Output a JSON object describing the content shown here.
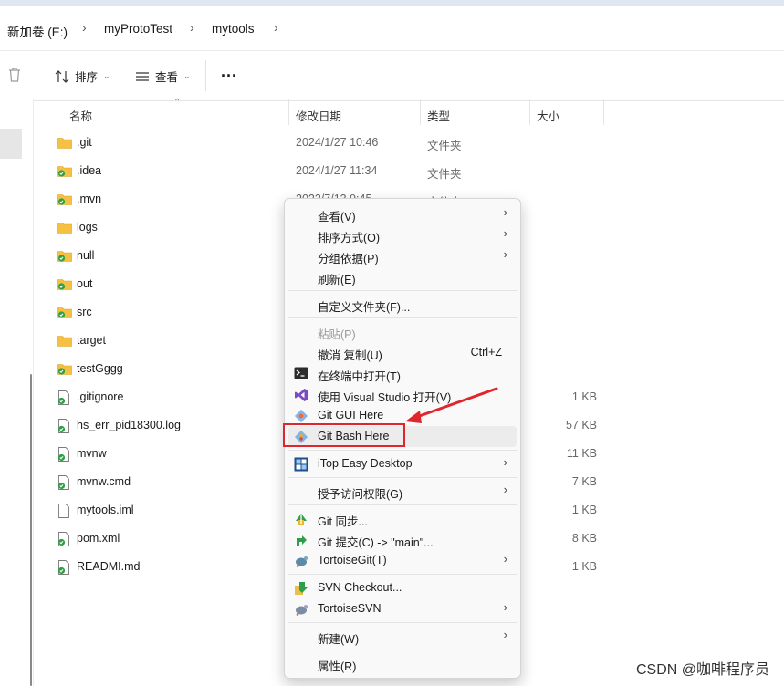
{
  "breadcrumb": {
    "items": [
      "新加卷 (E:)",
      "myProtoTest",
      "mytools"
    ],
    "separator": ">"
  },
  "toolbar": {
    "sort_label": "排序",
    "view_label": "查看",
    "more_label": "..."
  },
  "columns": {
    "name": "名称",
    "date": "修改日期",
    "type": "类型",
    "size": "大小"
  },
  "files": [
    {
      "name": ".git",
      "date": "2024/1/27 10:46",
      "type": "文件夹",
      "size": "",
      "kind": "folder"
    },
    {
      "name": ".idea",
      "date": "2024/1/27 11:34",
      "type": "文件夹",
      "size": "",
      "kind": "folder-ok"
    },
    {
      "name": ".mvn",
      "date": "2023/7/13 9:45",
      "type": "文件夹",
      "size": "",
      "kind": "folder-ok"
    },
    {
      "name": "logs",
      "date": "",
      "type": "",
      "size": "",
      "kind": "folder"
    },
    {
      "name": "null",
      "date": "",
      "type": "",
      "size": "",
      "kind": "folder-ok"
    },
    {
      "name": "out",
      "date": "",
      "type": "",
      "size": "",
      "kind": "folder-ok"
    },
    {
      "name": "src",
      "date": "",
      "type": "",
      "size": "",
      "kind": "folder-ok"
    },
    {
      "name": "target",
      "date": "",
      "type": "",
      "size": "",
      "kind": "folder"
    },
    {
      "name": "testGggg",
      "date": "",
      "type": "",
      "size": "",
      "kind": "folder-ok"
    },
    {
      "name": ".gitignore",
      "date": "",
      "type": "",
      "size": "1 KB",
      "kind": "file-ok"
    },
    {
      "name": "hs_err_pid18300.log",
      "date": "",
      "type": "",
      "size": "57 KB",
      "kind": "file-ok"
    },
    {
      "name": "mvnw",
      "date": "",
      "type": "",
      "size": "11 KB",
      "kind": "file-ok"
    },
    {
      "name": "mvnw.cmd",
      "date": "",
      "type": "",
      "size": "7 KB",
      "kind": "file-ok"
    },
    {
      "name": "mytools.iml",
      "date": "",
      "type": "",
      "size": "1 KB",
      "kind": "file"
    },
    {
      "name": "pom.xml",
      "date": "",
      "type": "",
      "size": "8 KB",
      "kind": "file-ok"
    },
    {
      "name": "READMI.md",
      "date": "",
      "type": "",
      "size": "1 KB",
      "kind": "file-ok"
    }
  ],
  "context_menu": {
    "groups": [
      [
        {
          "label": "查看(V)",
          "submenu": true
        },
        {
          "label": "排序方式(O)",
          "submenu": true
        },
        {
          "label": "分组依据(P)",
          "submenu": true
        },
        {
          "label": "刷新(E)"
        }
      ],
      [
        {
          "label": "自定义文件夹(F)..."
        }
      ],
      [
        {
          "label": "粘贴(P)",
          "disabled": true
        },
        {
          "label": "撤消 复制(U)",
          "shortcut": "Ctrl+Z"
        },
        {
          "label": "在终端中打开(T)",
          "icon": "terminal-icon"
        },
        {
          "label": "使用 Visual Studio 打开(V)",
          "icon": "visual-studio-icon"
        },
        {
          "label": "Git GUI Here",
          "icon": "git-gui-icon"
        },
        {
          "label": "Git Bash Here",
          "icon": "git-bash-icon",
          "hover": true
        }
      ],
      [
        {
          "label": "iTop Easy Desktop",
          "icon": "itop-icon",
          "submenu": true
        }
      ],
      [
        {
          "label": "授予访问权限(G)",
          "submenu": true
        }
      ],
      [
        {
          "label": "Git 同步...",
          "icon": "git-sync-icon"
        },
        {
          "label": "Git 提交(C) -> \"main\"...",
          "icon": "git-commit-icon"
        },
        {
          "label": "TortoiseGit(T)",
          "icon": "tortoisegit-icon",
          "submenu": true
        }
      ],
      [
        {
          "label": "SVN Checkout...",
          "icon": "svn-checkout-icon"
        },
        {
          "label": "TortoiseSVN",
          "icon": "tortoisesvn-icon",
          "submenu": true
        }
      ],
      [
        {
          "label": "新建(W)",
          "submenu": true
        }
      ],
      [
        {
          "label": "属性(R)"
        }
      ]
    ]
  },
  "watermark": "CSDN @咖啡程序员",
  "colors": {
    "highlight": "#e0262c",
    "folder": "#f6c143",
    "ok_badge": "#2ea043"
  }
}
